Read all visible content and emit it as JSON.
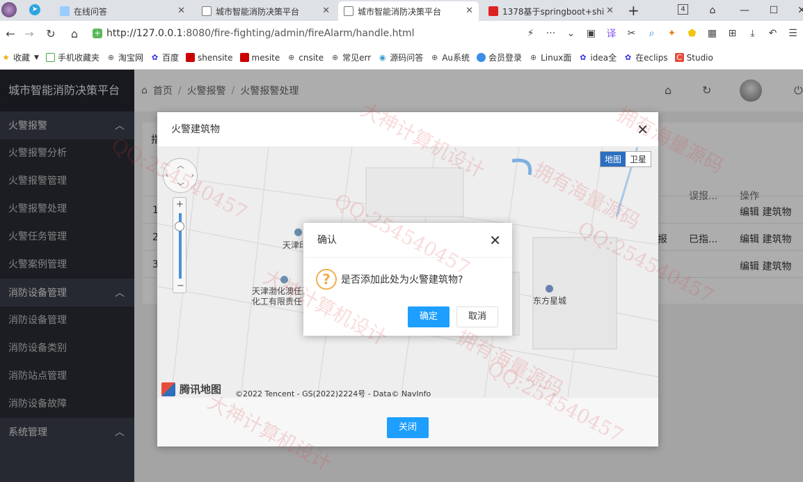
{
  "browser": {
    "tabs": [
      {
        "title": "在线问答",
        "active": false
      },
      {
        "title": "城市智能消防决策平台",
        "active": false
      },
      {
        "title": "城市智能消防决策平台",
        "active": true
      },
      {
        "title": "1378基于springboot+shi",
        "active": false
      }
    ],
    "tab_count_badge": "4",
    "url_host": "http://127.0.0.1",
    "url_path": ":8080/fire-fighting/admin/fireAlarm/handle.html",
    "bookmarks": [
      "收藏",
      "手机收藏夹",
      "淘宝网",
      "百度",
      "shensite",
      "mesite",
      "cnsite",
      "常见err",
      "源码问答",
      "Au系统",
      "会员登录",
      "Linux面",
      "idea全",
      "在eclips",
      "Studio"
    ]
  },
  "app": {
    "brand": "城市智能消防决策平台",
    "breadcrumb": [
      "首页",
      "火警报警",
      "火警报警处理"
    ],
    "menu": [
      {
        "group": "火警报警",
        "items": [
          "火警报警分析",
          "火警报警管理",
          "火警报警处理",
          "火警任务管理",
          "火警案例管理"
        ]
      },
      {
        "group": "消防设备管理",
        "items": [
          "消防设备管理",
          "消防设备类别",
          "消防站点管理",
          "消防设备故障"
        ]
      },
      {
        "group": "系统管理",
        "items": []
      }
    ],
    "table": {
      "partial_header": "指",
      "col_false_report": "误报...",
      "col_ops": "操作",
      "rows": [
        {
          "no": "1",
          "status": "",
          "ops": "编辑 建筑物"
        },
        {
          "no": "2",
          "status": "报",
          "assigned": "已指...",
          "ops": "编辑 建筑物"
        },
        {
          "no": "3",
          "status": "",
          "ops": "编辑 建筑物"
        }
      ]
    }
  },
  "layer": {
    "title": "火警建筑物",
    "close_button": "关闭",
    "map": {
      "type_buttons": [
        "地图",
        "卫星"
      ],
      "labels": [
        "天津印",
        "天津渤化澳任达",
        "化工有限责任",
        "东方星城"
      ],
      "logo_text": "腾讯地图",
      "copyright": "©2022 Tencent - GS(2022)2224号 - Data© NavInfo"
    }
  },
  "confirm": {
    "title": "确认",
    "message": "是否添加此处为火警建筑物?",
    "ok": "确定",
    "cancel": "取消"
  },
  "watermarks": [
    "QQ:254540457",
    "大神计算机设计",
    "拥有海量源码",
    "QQ:254540457",
    "大神计算机设计",
    "拥有海量源码",
    "QQ:254540457",
    "QQ:254540457",
    "大神计算机设计",
    "拥有海量源码"
  ]
}
